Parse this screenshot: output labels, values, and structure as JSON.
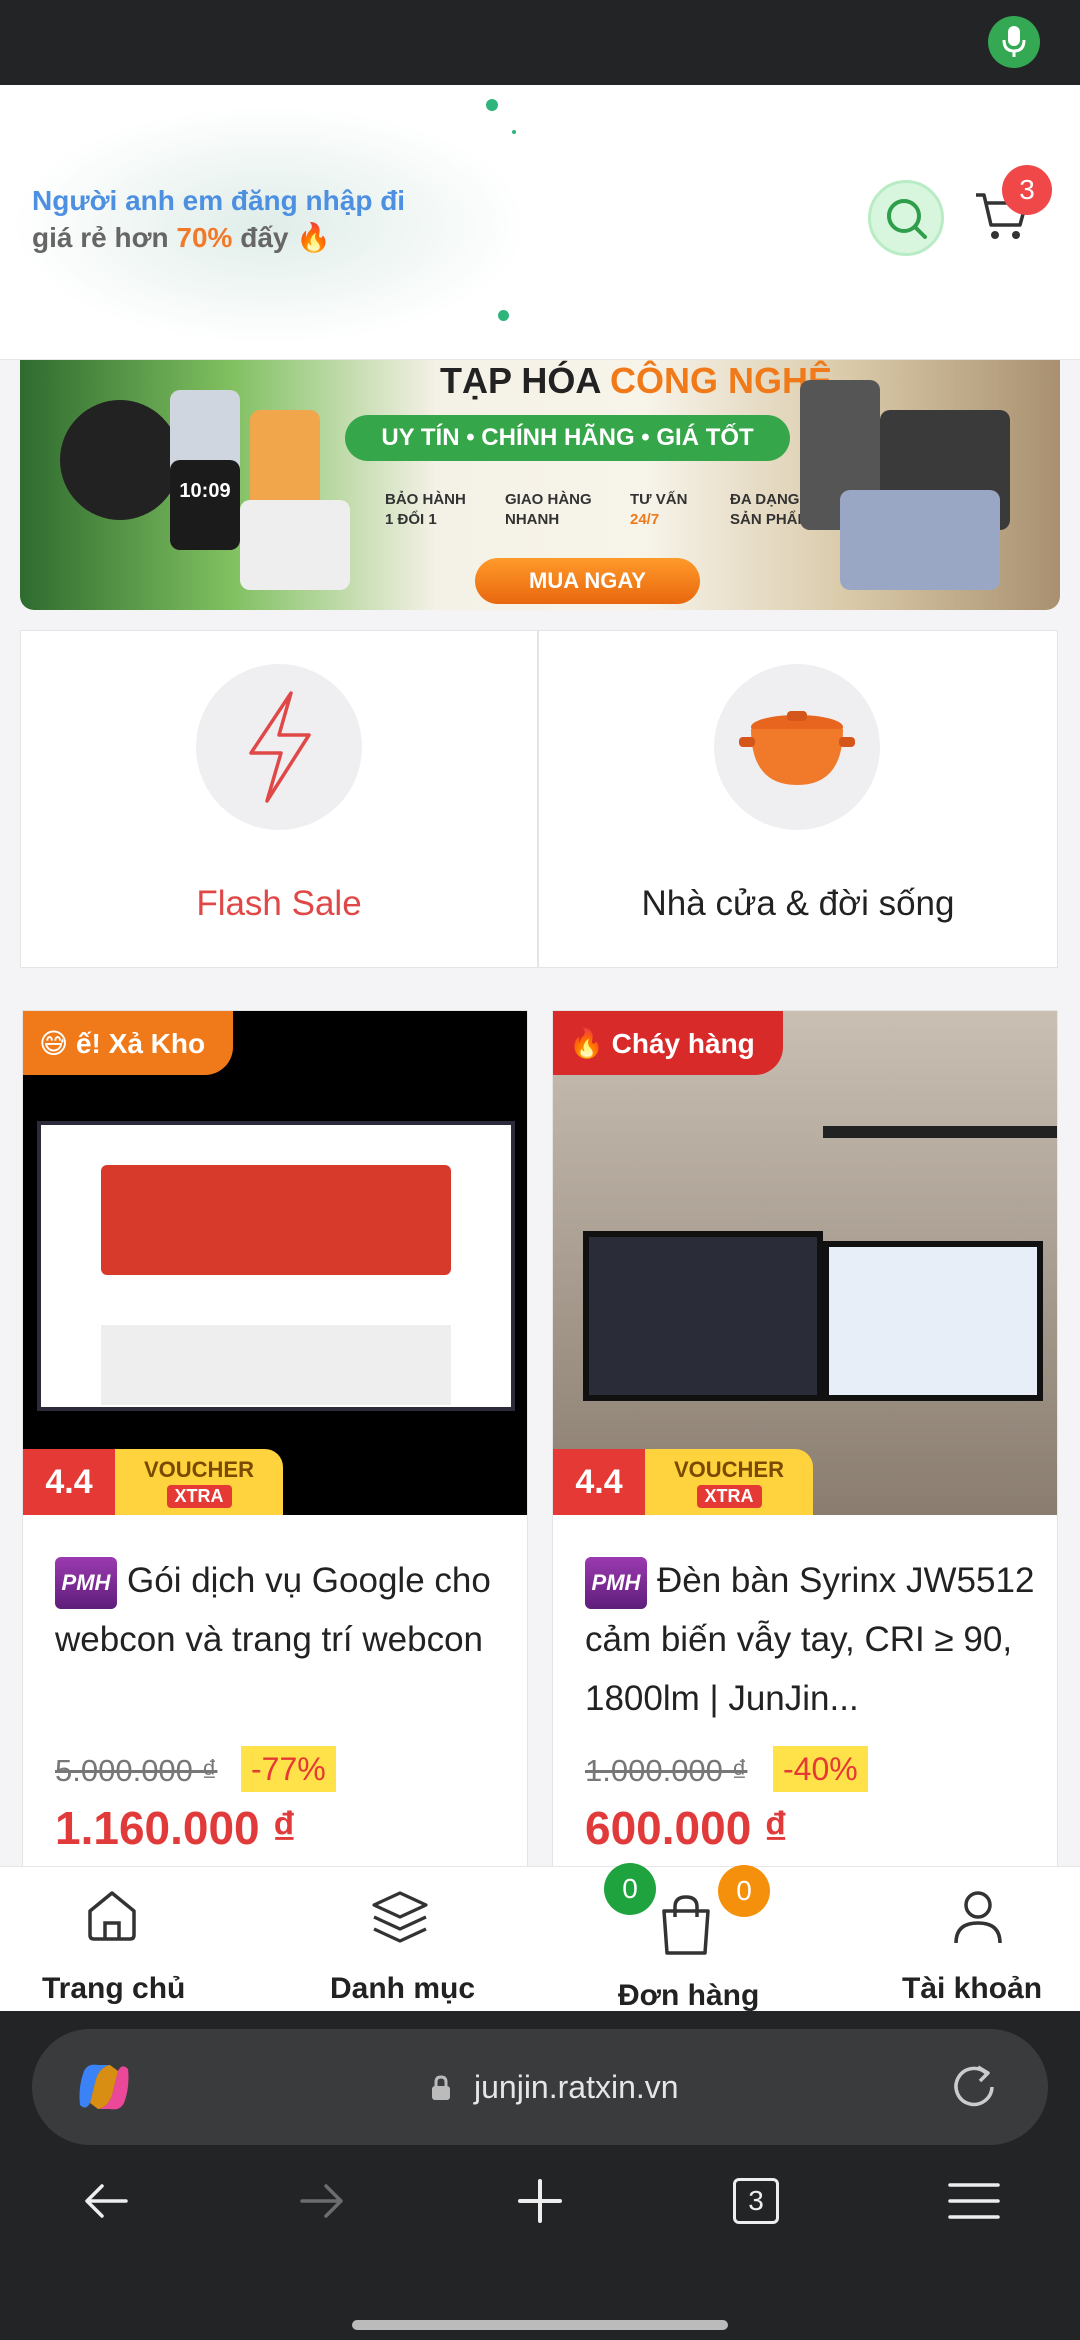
{
  "header": {
    "login_line1": "Người anh em đăng nhập đi",
    "login_line2_prefix": "giá rẻ hơn",
    "login_line2_pct": "70%",
    "login_line2_suffix": "đấy 🔥",
    "cart_count": "3"
  },
  "banner": {
    "title_part1": "TẠP HÓA",
    "title_part2": "CÔNG NGHỆ",
    "pill": "UY TÍN • CHÍNH HÃNG • GIÁ TỐT",
    "features": [
      {
        "line1": "BẢO HÀNH",
        "line2": "1 ĐỔI 1"
      },
      {
        "line1": "GIAO HÀNG",
        "line2": "NHANH"
      },
      {
        "line1": "TƯ VẤN",
        "line2": "24/7"
      },
      {
        "line1": "ĐA DẠNG",
        "line2": "SẢN PHẨM"
      }
    ],
    "watch_time": "10:09",
    "buy_button": "MUA NGAY"
  },
  "categories": [
    {
      "label": "Flash Sale",
      "icon": "lightning-icon",
      "color": "#e04848"
    },
    {
      "label": "Nhà cửa & đời sống",
      "icon": "pot-icon",
      "color": "#222222"
    }
  ],
  "products": [
    {
      "tag": "😅 ế! Xả Kho",
      "tag_color": "#f07a1a",
      "rating": "4.4",
      "voucher_line1": "VOUCHER",
      "voucher_line2": "XTRA",
      "brand": "PMH",
      "title": "Gói dịch vụ Google cho webcon và trang trí webcon",
      "old_price": "5.000.000 ₫",
      "discount": "-77%",
      "new_price": "1.160.000 ₫"
    },
    {
      "tag": "🔥 Cháy hàng",
      "tag_color": "#d92a2a",
      "rating": "4.4",
      "voucher_line1": "VOUCHER",
      "voucher_line2": "XTRA",
      "brand": "PMH",
      "title": "Đèn bàn Syrinx JW5512 cảm biến vẫy tay, CRI ≥ 90, 1800lm | JunJin...",
      "old_price": "1.000.000 ₫",
      "discount": "-40%",
      "new_price": "600.000 ₫"
    }
  ],
  "bottom_nav": {
    "home": "Trang chủ",
    "categories": "Danh mục",
    "orders": "Đơn hàng",
    "orders_badge_green": "0",
    "orders_badge_orange": "0",
    "account": "Tài khoản"
  },
  "browser": {
    "url": "junjin.ratxin.vn",
    "tab_count": "3"
  },
  "colors": {
    "accent_red": "#e03a3a",
    "accent_green": "#34a853",
    "accent_orange": "#f07a1a"
  }
}
